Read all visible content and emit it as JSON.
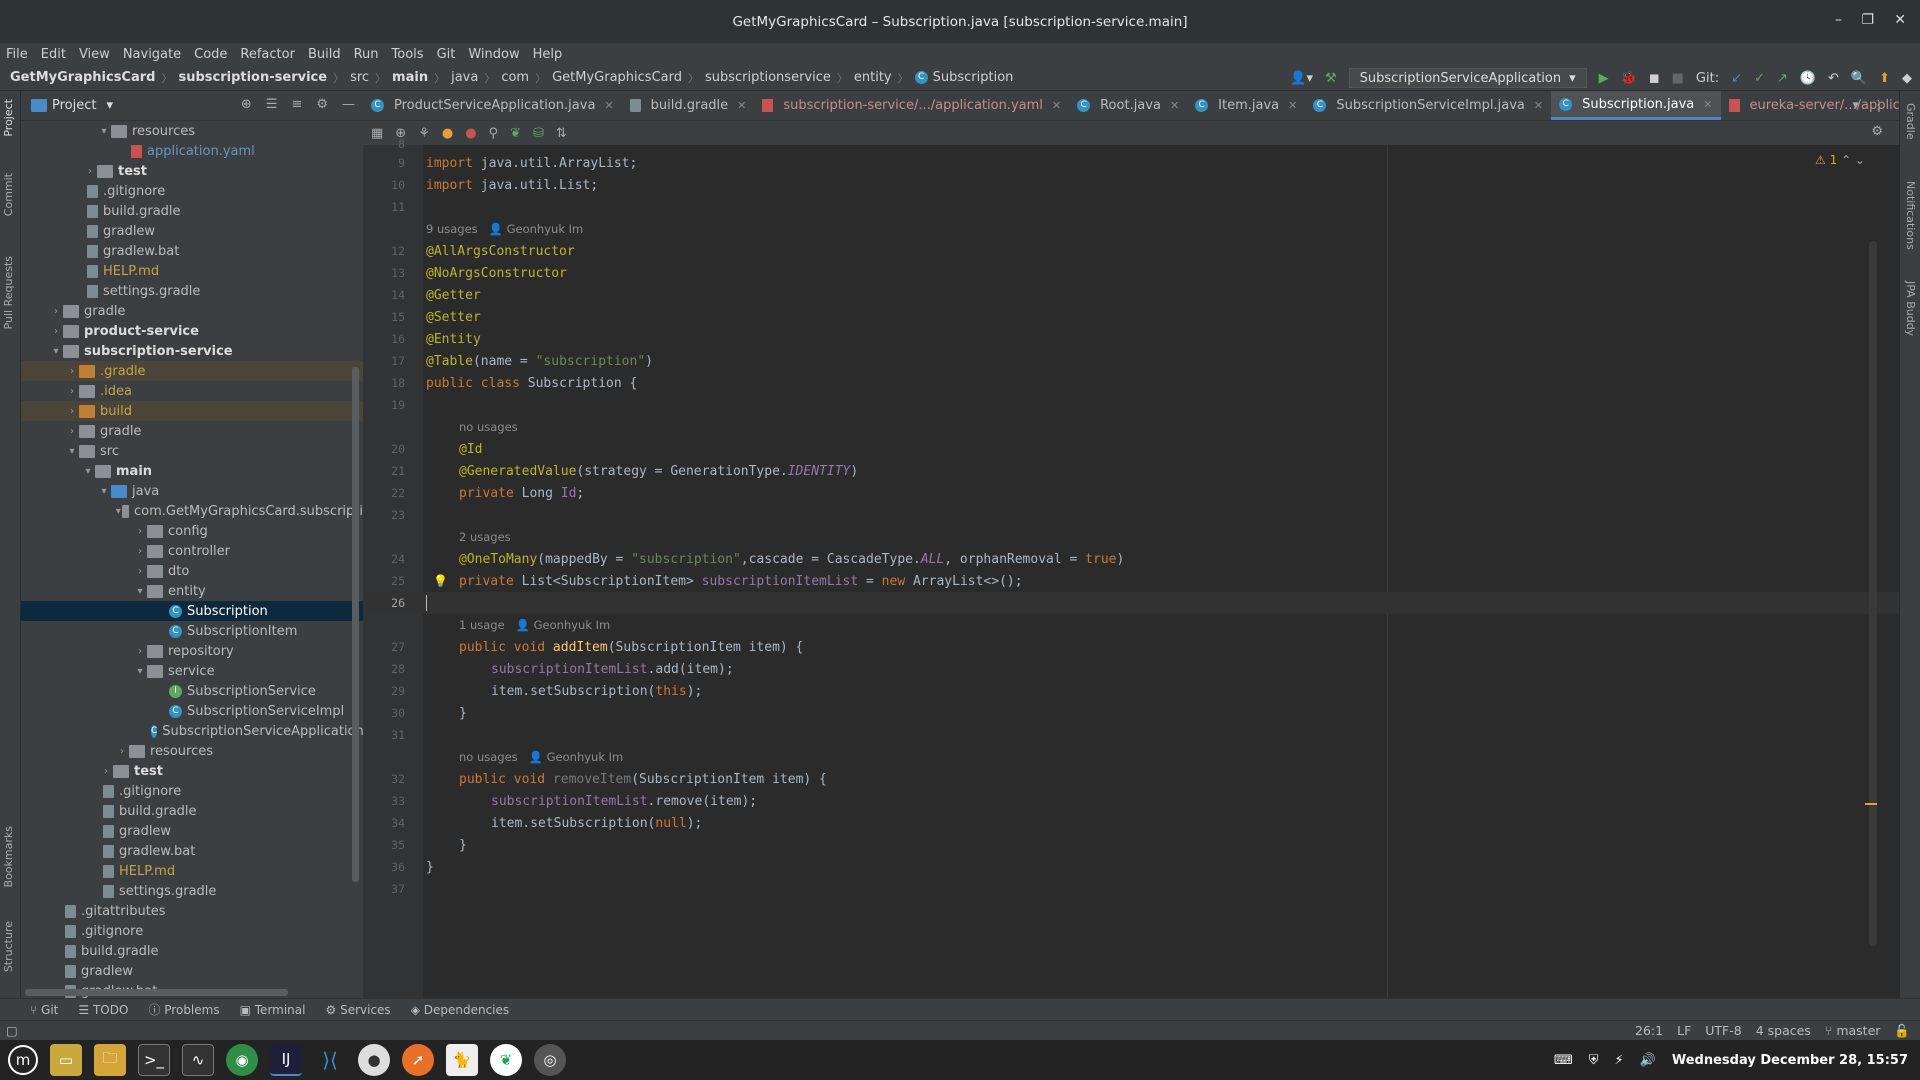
{
  "window": {
    "title": "GetMyGraphicsCard – Subscription.java [subscription-service.main]"
  },
  "menu": [
    "File",
    "Edit",
    "View",
    "Navigate",
    "Code",
    "Refactor",
    "Build",
    "Run",
    "Tools",
    "Git",
    "Window",
    "Help"
  ],
  "breadcrumb": [
    "GetMyGraphicsCard",
    "subscription-service",
    "src",
    "main",
    "java",
    "com",
    "GetMyGraphicsCard",
    "subscriptionservice",
    "entity",
    "Subscription"
  ],
  "toolbar": {
    "run_config": "SubscriptionServiceApplication",
    "git_label": "Git:"
  },
  "project_panel": {
    "title": "Project",
    "tree": [
      {
        "label": "resources",
        "kind": "folder"
      },
      {
        "label": "application.yaml",
        "kind": "yaml"
      },
      {
        "label": "test",
        "kind": "folder"
      },
      {
        "label": ".gitignore",
        "kind": "file"
      },
      {
        "label": "build.gradle",
        "kind": "file"
      },
      {
        "label": "gradlew",
        "kind": "file"
      },
      {
        "label": "gradlew.bat",
        "kind": "file"
      },
      {
        "label": "HELP.md",
        "kind": "file"
      },
      {
        "label": "settings.gradle",
        "kind": "file"
      },
      {
        "label": "gradle",
        "kind": "folder"
      },
      {
        "label": "product-service",
        "kind": "folder"
      },
      {
        "label": "subscription-service",
        "kind": "folder"
      },
      {
        "label": ".gradle",
        "kind": "folder"
      },
      {
        "label": ".idea",
        "kind": "folder"
      },
      {
        "label": "build",
        "kind": "folder"
      },
      {
        "label": "gradle",
        "kind": "folder"
      },
      {
        "label": "src",
        "kind": "folder"
      },
      {
        "label": "main",
        "kind": "folder"
      },
      {
        "label": "java",
        "kind": "folder"
      },
      {
        "label": "com.GetMyGraphicsCard.subscripti",
        "kind": "folder"
      },
      {
        "label": "config",
        "kind": "folder"
      },
      {
        "label": "controller",
        "kind": "folder"
      },
      {
        "label": "dto",
        "kind": "folder"
      },
      {
        "label": "entity",
        "kind": "folder"
      },
      {
        "label": "Subscription",
        "kind": "class"
      },
      {
        "label": "SubscriptionItem",
        "kind": "class"
      },
      {
        "label": "repository",
        "kind": "folder"
      },
      {
        "label": "service",
        "kind": "folder"
      },
      {
        "label": "SubscriptionService",
        "kind": "interface"
      },
      {
        "label": "SubscriptionServiceImpl",
        "kind": "class"
      },
      {
        "label": "SubscriptionServiceApplication",
        "kind": "class"
      },
      {
        "label": "resources",
        "kind": "folder"
      },
      {
        "label": "test",
        "kind": "folder"
      },
      {
        "label": ".gitignore",
        "kind": "file"
      },
      {
        "label": "build.gradle",
        "kind": "file"
      },
      {
        "label": "gradlew",
        "kind": "file"
      },
      {
        "label": "gradlew.bat",
        "kind": "file"
      },
      {
        "label": "HELP.md",
        "kind": "file"
      },
      {
        "label": "settings.gradle",
        "kind": "file"
      },
      {
        "label": ".gitattributes",
        "kind": "file"
      },
      {
        "label": ".gitignore",
        "kind": "file"
      },
      {
        "label": "build.gradle",
        "kind": "file"
      },
      {
        "label": "gradlew",
        "kind": "file"
      },
      {
        "label": "gradlew.bat",
        "kind": "file"
      }
    ]
  },
  "editor_tabs": [
    {
      "label": "ProductServiceApplication.java"
    },
    {
      "label": "build.gradle"
    },
    {
      "label": "subscription-service/.../application.yaml"
    },
    {
      "label": "Root.java"
    },
    {
      "label": "Item.java"
    },
    {
      "label": "SubscriptionServiceImpl.java"
    },
    {
      "label": "Subscription.java",
      "active": true
    },
    {
      "label": "eureka-server/.../application.yaml"
    }
  ],
  "editor": {
    "warning_count": "1",
    "hints": {
      "h11": "9 usages",
      "h11_author": "Geonhyuk Im",
      "h19": "no usages",
      "h23": "2 usages",
      "h26": "1 usage",
      "h26_author": "Geonhyuk Im",
      "h31": "no usages",
      "h31_author": "Geonhyuk Im"
    },
    "line_numbers": [
      "8",
      "9",
      "10",
      "11",
      "12",
      "13",
      "14",
      "15",
      "16",
      "17",
      "18",
      "19",
      "20",
      "21",
      "22",
      "23",
      "24",
      "25",
      "26",
      "27",
      "28",
      "29",
      "30",
      "31",
      "32",
      "33",
      "34",
      "35",
      "36",
      "37"
    ]
  },
  "bottom_tools": [
    "Git",
    "TODO",
    "Problems",
    "Terminal",
    "Services",
    "Dependencies"
  ],
  "status": {
    "position": "26:1",
    "line_sep": "LF",
    "encoding": "UTF-8",
    "indent": "4 spaces",
    "branch": "master"
  },
  "side_tabs_left": [
    "Project",
    "Commit",
    "Pull Requests",
    "Bookmarks",
    "Structure"
  ],
  "side_tabs_right": [
    "Gradle",
    "Notifications",
    "JPA Buddy"
  ],
  "taskbar": {
    "clock": "Wednesday December 28, 15:57"
  }
}
